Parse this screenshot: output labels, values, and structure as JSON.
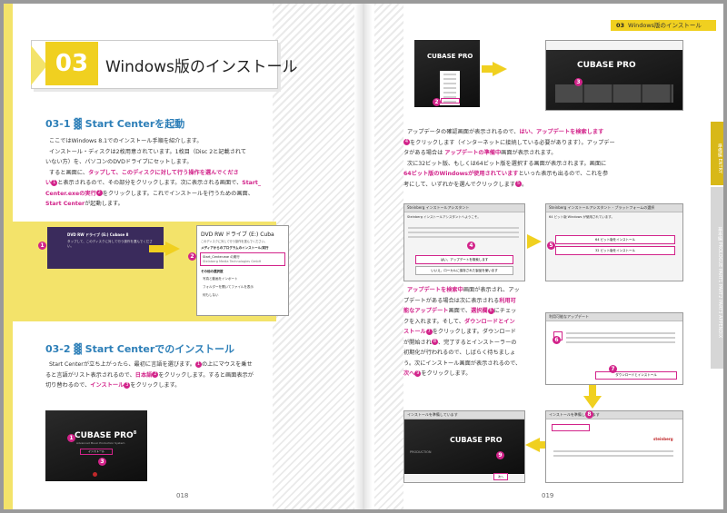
{
  "header": {
    "chapter_number": "03",
    "chapter_title": "Windows版のインストール",
    "running_head_number": "03",
    "running_head_title": "Windows版のインストール"
  },
  "side_tabs": [
    "準備編",
    "ENTRY",
    "基本編",
    "PROLOGUE",
    "PART1",
    "PART2",
    "PART3",
    "APPENDIX"
  ],
  "left_page": {
    "section1_title": "03-1 ▓ Start Centerを起動",
    "section1_text": [
      "ここではWindows 8.1でのインストール手順を紹介します。",
      "インストール・ディスクは2枚用意されています。1枚目（Disc 2と記載されて",
      "いない方）を、パソコンのDVDドライブにセットします。",
      "すると画面に、"
    ],
    "section1_hl1": "タップして、このディスクに対して行う操作を選んでくださ",
    "section1_hl1b": "い",
    "section1_t2": "と表示されるので、その部分をクリックします。次に表示される画面で、",
    "section1_hl2": "Start_",
    "section1_hl2b": "Center.exeの実行",
    "section1_t3": "をクリックします。これでインストールを行うための画面、",
    "section1_hl3": "Start Center",
    "section1_t4": "が起動します。",
    "section2_title": "03-2 ▓ Start Centerでのインストール",
    "section2_t1": "Start Centerが立ち上がったら、最初に言語を選びます。",
    "section2_t2": "の上にマウスを乗せ",
    "section2_t3": "ると言語がリスト表示されるので、",
    "section2_hl1": "日本語",
    "section2_t4": "をクリックします。すると画面表示が",
    "section2_t5": "切り替わるので、",
    "section2_hl2": "インストール",
    "section2_t6": "をクリックします。",
    "page_number": "018",
    "dvd_notice_title": "DVD RW ドライブ (E:) Cubase 8",
    "dvd_notice_sub": "タップして、このディスクに対して行う操作を選んでください。",
    "dvd_panel_title": "DVD RW ドライブ (E:) Cuba",
    "dvd_panel_sub": "このディスクに対して行う操作を選んでください。",
    "dvd_panel_head": "メディアからのプログラムのインストール/実行",
    "dvd_panel_opt1": "Start_Center.exe の実行",
    "dvd_panel_opt1b": "Steinberg Media Technologies GmbH",
    "dvd_panel_head2": "その他の選択肢",
    "dvd_panel_opt2": "フォルダーを開いてファイルを表示",
    "dvd_panel_opt3": "写真と動画をインポート",
    "dvd_panel_opt4": "何もしない",
    "cubase_logo": "CUBASE PRO",
    "cubase_ver": "8",
    "cubase_sub": "Advanced Music Production System",
    "install_btn": "インストール"
  },
  "right_page": {
    "p1_t1": "アップデータの確認画面が表示されるので、",
    "p1_hl1": "はい、アップデートを検索します",
    "p1_t2": "をクリックします（インターネットに接続している必要があります）。アップデー",
    "p1_t3": "タがある場合は",
    "p1_hl2": "アップデートの準備中",
    "p1_t4": "画面が表示されます。",
    "p1_t5": "次に32ビット版、もしくは64ビット版を選択する画面が表示されます。画面に",
    "p1_hl3": "64ビット版のWindowsが使用されています",
    "p1_t6": "といった表示も出るので、これを参",
    "p1_t7": "考にして、いずれかを選んでクリックします",
    "p2_hl1": "アップデートを検索中",
    "p2_t1": "画面が表示され、アッ",
    "p2_t2": "プデートがある場合は次に表示される",
    "p2_hl2": "利用可",
    "p2_hl2b": "能なアップデート",
    "p2_t3": "画面で、",
    "p2_hl3": "選択欄",
    "p2_t4": "にチェッ",
    "p2_t5": "クを入れます。そして、",
    "p2_hl4": "ダウンロードとイン",
    "p2_hl4b": "ストール",
    "p2_t6": "をクリックします。ダウンロード",
    "p2_t7": "が開始され",
    "p2_t8": "、完了するとインストーラーの",
    "p2_t9": "初期化が行われるので、しばらく待ちましょ",
    "p2_t10": "う。次にインストール画面が表示されるので、",
    "p2_hl5": "次へ",
    "p2_t11": "をクリックします。",
    "page_number": "019",
    "dlg1_title": "Steinberg インストールアシスタント",
    "dlg1_text": "Steinberg インストールアシスタントへようこそ。",
    "dlg1_btn1": "はい、アップデートを検索します",
    "dlg1_btn2": "いいえ、ローカルに保存された製品を使います",
    "dlg2_title": "Steinberg インストールアシスタント - プラットフォームの選択",
    "dlg2_text": "64 ビット版 Windows が使用されています。",
    "dlg2_opt1": "64 ビット版をインストール",
    "dlg2_opt2": "32 ビット版をインストール",
    "dlg3_title": "利用可能なアップデート",
    "dlg3_btn": "ダウンロードとインストール",
    "dlg4_title": "インストールを準備しています",
    "dlg4_btn": "次へ",
    "steinberg": "steinberg",
    "prod_label": "PRODUCTION"
  },
  "markers": [
    "1",
    "2",
    "3",
    "4",
    "5",
    "6",
    "7",
    "8",
    "9"
  ]
}
